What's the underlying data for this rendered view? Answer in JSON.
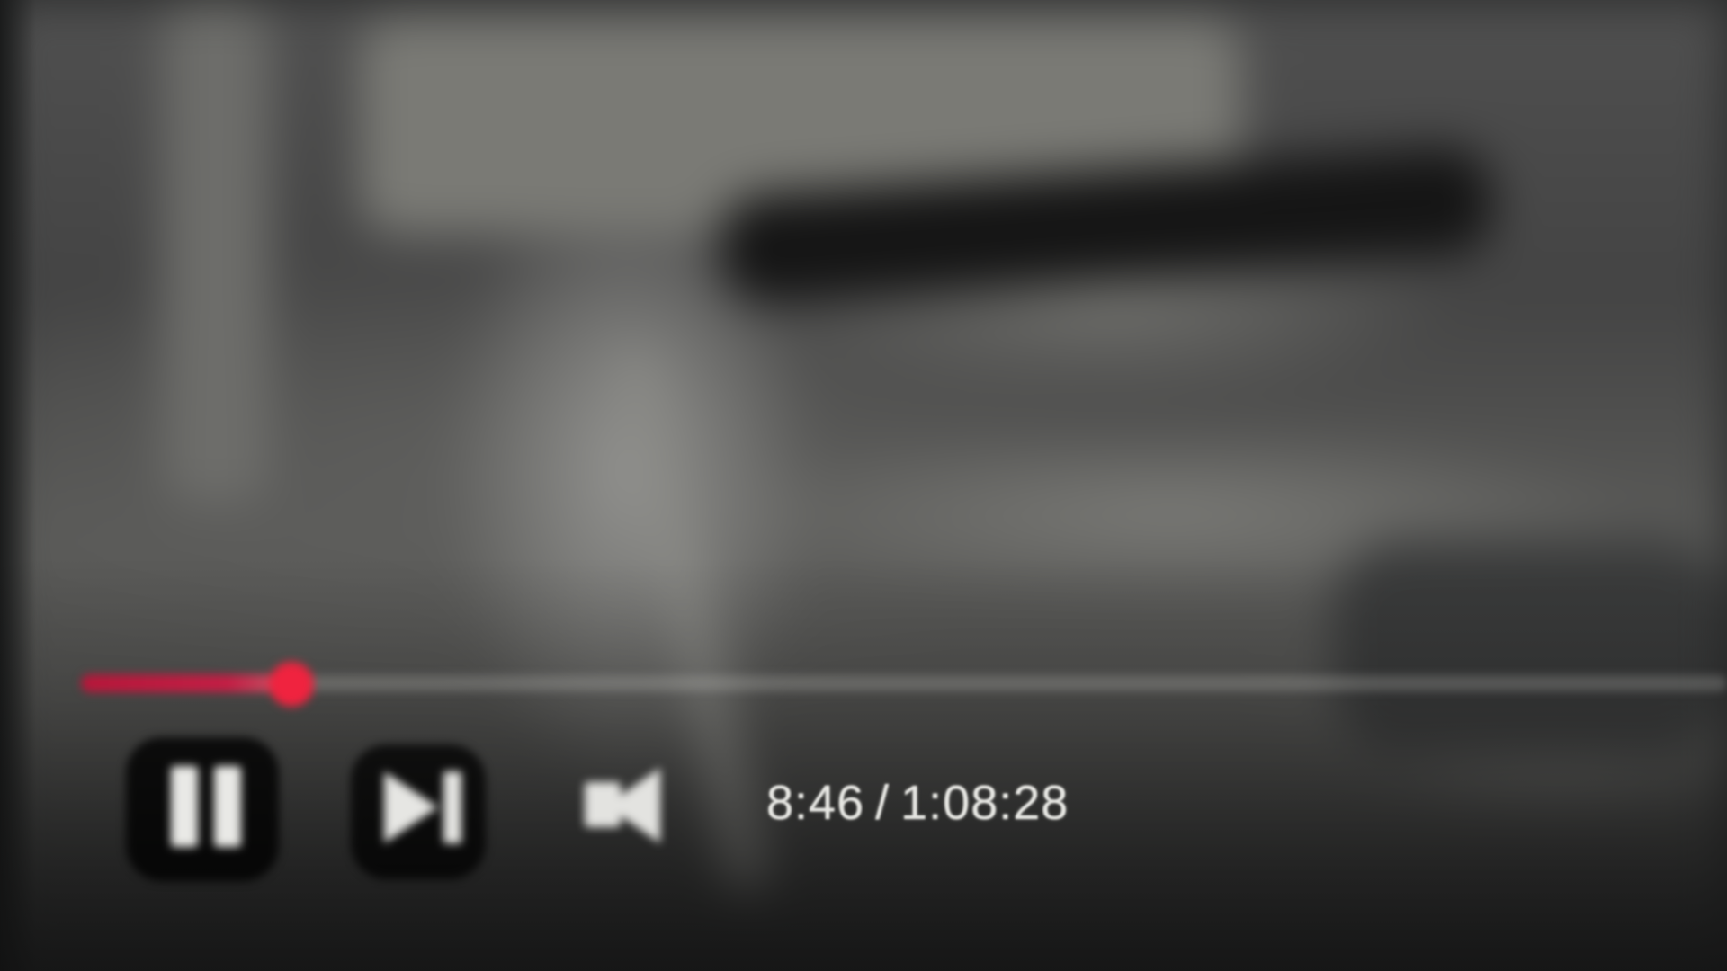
{
  "player": {
    "playback_state": "playing",
    "progress": {
      "played_fraction": 0.128,
      "played_color": "#c51e45",
      "scrubber_color": "#f0233f"
    },
    "controls": {
      "play_pause_icon": "pause-icon",
      "next_icon": "next-track-icon",
      "volume_icon": "volume-icon"
    },
    "time": {
      "current": "8:46",
      "separator": "/",
      "duration": "1:08:28"
    }
  }
}
